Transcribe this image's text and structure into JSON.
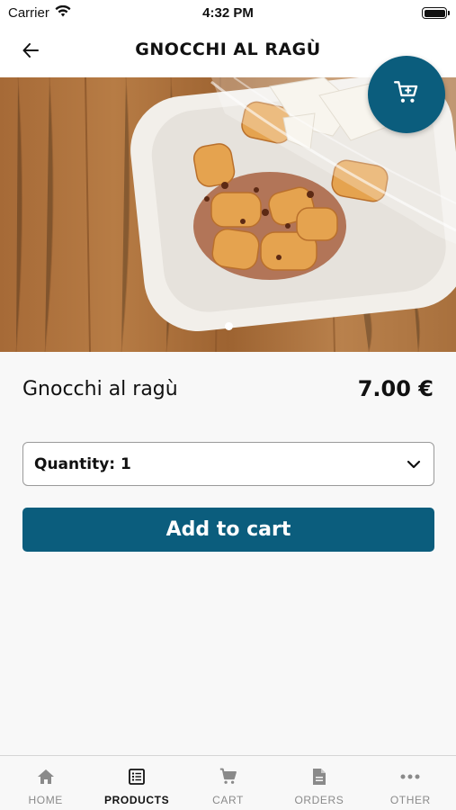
{
  "status_bar": {
    "carrier": "Carrier",
    "time": "4:32 PM"
  },
  "nav": {
    "title": "GNOCCHI AL RAGÙ",
    "back_icon": "arrow-left-icon"
  },
  "cart_fab": {
    "icon": "shopping-cart-icon"
  },
  "product": {
    "name": "Gnocchi al ragù",
    "price": "7.00 €",
    "image_page_count": 1,
    "image_page_active": 1
  },
  "quantity": {
    "label": "Quantity: 1",
    "selected_value": 1
  },
  "add_to_cart": {
    "label": "Add to cart"
  },
  "tabs": [
    {
      "label": "HOME",
      "icon": "home-icon",
      "active": false
    },
    {
      "label": "PRODUCTS",
      "icon": "list-icon",
      "active": true
    },
    {
      "label": "CART",
      "icon": "cart-icon",
      "active": false
    },
    {
      "label": "ORDERS",
      "icon": "document-icon",
      "active": false
    },
    {
      "label": "OTHER",
      "icon": "more-dots-icon",
      "active": false
    }
  ],
  "colors": {
    "primary": "#0b5d7d",
    "inactive_tab": "#8a8a8a",
    "active_tab": "#111111"
  }
}
